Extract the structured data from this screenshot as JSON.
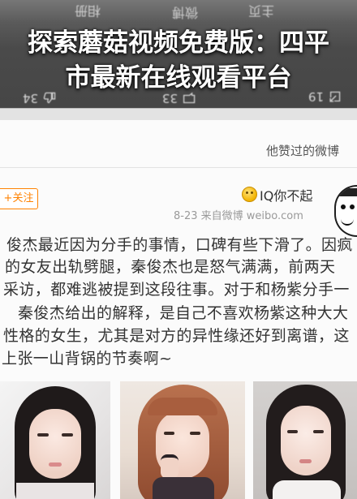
{
  "overlay_title": {
    "line1": "探索蘑菇视频免费版：四平",
    "line2": "市最新在线观看平台"
  },
  "background_tabs": [
    "相册",
    "微博",
    "主页"
  ],
  "action_bar": {
    "like_count": "34",
    "comment_count": "33",
    "share_count": "19"
  },
  "section_header": "他赞过的微博",
  "post": {
    "follow_label": "+关注",
    "author": "IQ你不起",
    "meta": "8-23  来自微博 weibo.com",
    "lines": [
      "俊杰最近因为分手的事情，口碑有些下滑了。因疯",
      "的女友出轨劈腿，秦俊杰也是怒气满满，前两天",
      "采访，都难逃被提到这段往事。对于和杨紫分手一",
      "秦俊杰给出的解释，是自己不喜欢杨紫这种大大",
      "性格的女生，尤其是对方的异性缘还好到离谱，这",
      "上张一山背锅的节奏啊~"
    ]
  },
  "icons": {
    "like": "like-icon",
    "comment": "comment-icon",
    "share": "share-icon",
    "badge": "vip-badge-icon"
  },
  "colors": {
    "accent": "#ff8200",
    "text": "#333333",
    "meta": "#9a9a9a",
    "title": "#ffffff"
  }
}
